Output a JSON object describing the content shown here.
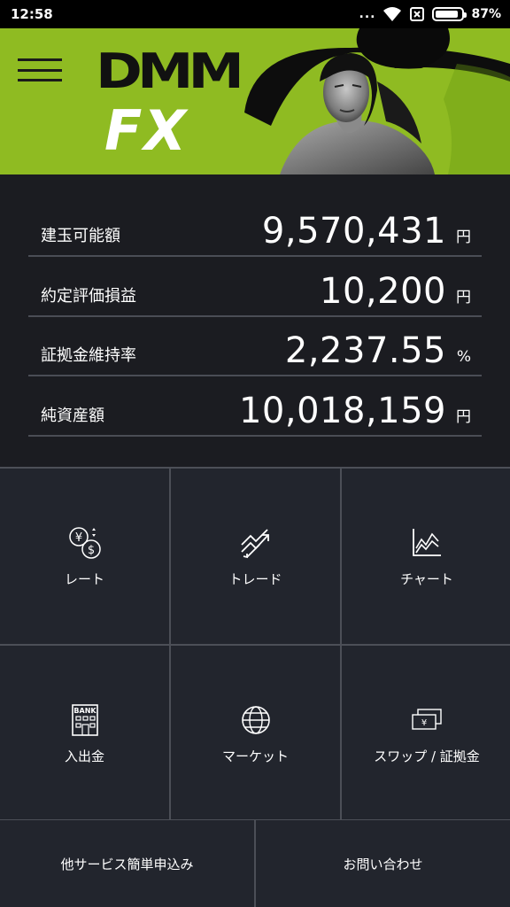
{
  "status_bar": {
    "time": "12:58",
    "dots": "...",
    "battery_percent": "87%",
    "battery_level": 0.87
  },
  "banner": {
    "logo_top": "DMM",
    "logo_bottom": "FX",
    "accent": "#8fbb22"
  },
  "account": [
    {
      "label": "建玉可能額",
      "value": "9,570,431",
      "unit": "円"
    },
    {
      "label": "約定評価損益",
      "value": "10,200",
      "unit": "円"
    },
    {
      "label": "証拠金維持率",
      "value": "2,237.55",
      "unit": "%"
    },
    {
      "label": "純資産額",
      "value": "10,018,159",
      "unit": "円"
    }
  ],
  "menu": [
    {
      "label": "レート",
      "icon": "currency-exchange-icon"
    },
    {
      "label": "トレード",
      "icon": "trade-trend-icon"
    },
    {
      "label": "チャート",
      "icon": "chart-icon"
    },
    {
      "label": "入出金",
      "icon": "bank-icon",
      "icon_text": "BANK"
    },
    {
      "label": "マーケット",
      "icon": "globe-icon"
    },
    {
      "label": "スワップ / 証拠金",
      "icon": "yen-notes-icon"
    }
  ],
  "bottom": {
    "services_label": "他サービス簡単申込み",
    "contact_label": "お問い合わせ"
  }
}
